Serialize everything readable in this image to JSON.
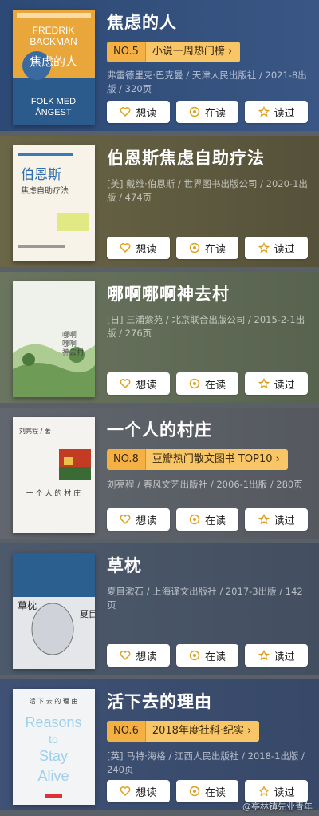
{
  "actions": {
    "want": "想读",
    "reading": "在读",
    "read": "读过"
  },
  "books": [
    {
      "title": "焦虑的人",
      "rank_no": "NO.5",
      "rank_label": "小说一周热门榜",
      "meta": "弗雷德里克·巴克曼 / 天津人民出版社 / 2021-8出版 / 320页",
      "cover_lines": [
        "FREDRIK",
        "BACKMAN",
        "焦虑的人",
        "FOLK MED",
        "ÅNGEST"
      ]
    },
    {
      "title": "伯恩斯焦虑自助疗法",
      "rank_no": "",
      "rank_label": "",
      "meta": "[美] 戴维·伯恩斯 / 世界图书出版公司 / 2020-1出版 / 474页",
      "cover_lines": [
        "伯恩斯",
        "焦虑自助疗法"
      ]
    },
    {
      "title": "哪啊哪啊神去村",
      "rank_no": "",
      "rank_label": "",
      "meta": "[日] 三浦紫苑 / 北京联合出版公司 / 2015-2-1出版 / 276页",
      "cover_lines": [
        "哪啊",
        "哪啊",
        "神去村"
      ]
    },
    {
      "title": "一个人的村庄",
      "rank_no": "NO.8",
      "rank_label": "豆瓣热门散文图书 TOP10",
      "meta": "刘亮程 / 春风文艺出版社 / 2006-1出版 / 280页",
      "cover_lines": [
        "刘亮程 / 著",
        "一 个 人 的 村 庄"
      ]
    },
    {
      "title": "草枕",
      "rank_no": "",
      "rank_label": "",
      "meta": "夏目漱石 / 上海译文出版社 / 2017-3出版 / 142页",
      "cover_lines": [
        "草枕",
        "夏目漱石"
      ]
    },
    {
      "title": "活下去的理由",
      "rank_no": "NO.6",
      "rank_label": "2018年度社科·纪实",
      "meta": "[英] 马特·海格 / 江西人民出版社 / 2018-1出版 / 240页",
      "cover_lines": [
        "活 下 去 的 理 由",
        "Reasons",
        "to",
        "Stay",
        "Alive"
      ]
    }
  ],
  "watermark": "@亭林镇先业青年",
  "colors": {
    "card_1": "#2f4f7c",
    "card_2": "#5e5a3f",
    "card_3": "#5f6b5a",
    "card_4": "#5c6068",
    "card_5": "#4a5668",
    "card_6": "#3e4f70",
    "rank_bg": "#f8c667"
  }
}
